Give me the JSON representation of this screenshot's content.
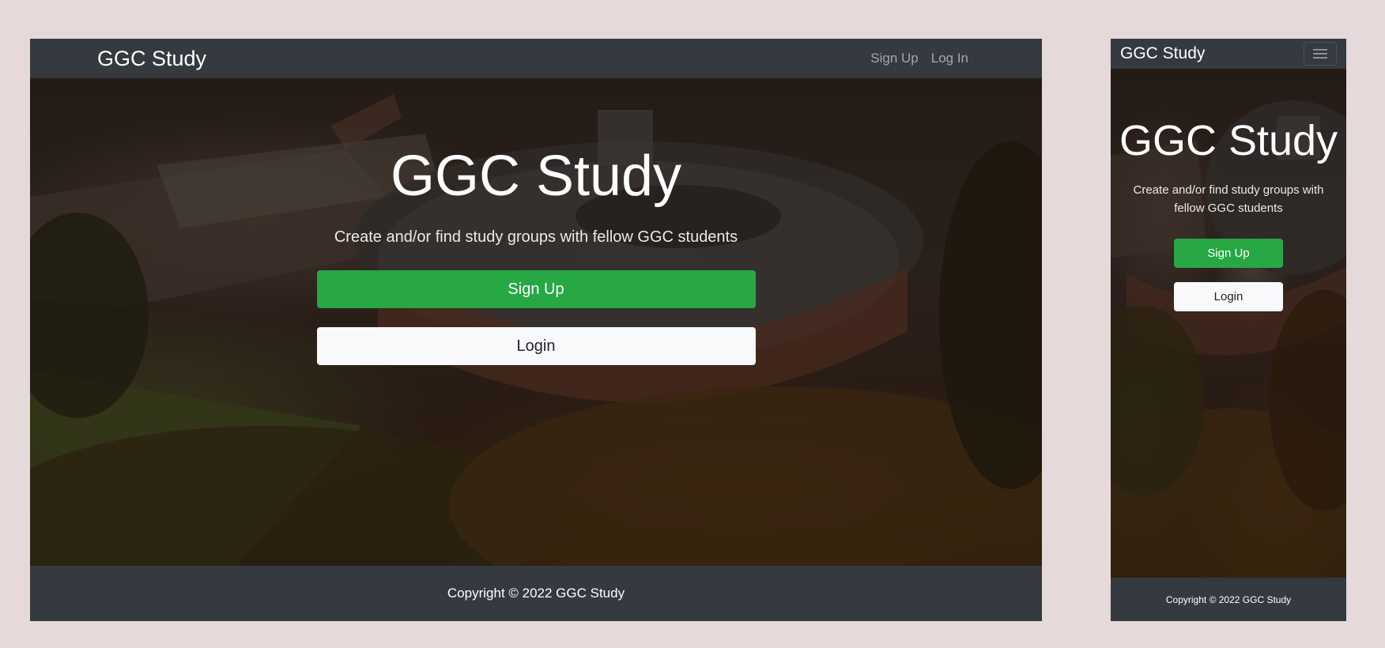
{
  "desktop": {
    "navbar": {
      "brand": "GGC Study",
      "links": [
        "Sign Up",
        "Log In"
      ]
    },
    "hero": {
      "title": "GGC Study",
      "subtitle": "Create and/or find study groups with fellow GGC students",
      "signup_label": "Sign Up",
      "login_label": "Login"
    },
    "footer": {
      "copyright": "Copyright © 2022 GGC Study"
    }
  },
  "mobile": {
    "navbar": {
      "brand": "GGC Study",
      "menu_icon": "hamburger-menu-icon"
    },
    "hero": {
      "title": "GGC Study",
      "subtitle": "Create and/or find study groups with fellow GGC students",
      "signup_label": "Sign Up",
      "login_label": "Login"
    },
    "footer": {
      "copyright": "Copyright © 2022 GGC Study"
    }
  },
  "colors": {
    "navbar": "#343a40",
    "success_button": "#28a745",
    "light_button": "#f8f9fa",
    "page_background": "#e6d9da"
  }
}
